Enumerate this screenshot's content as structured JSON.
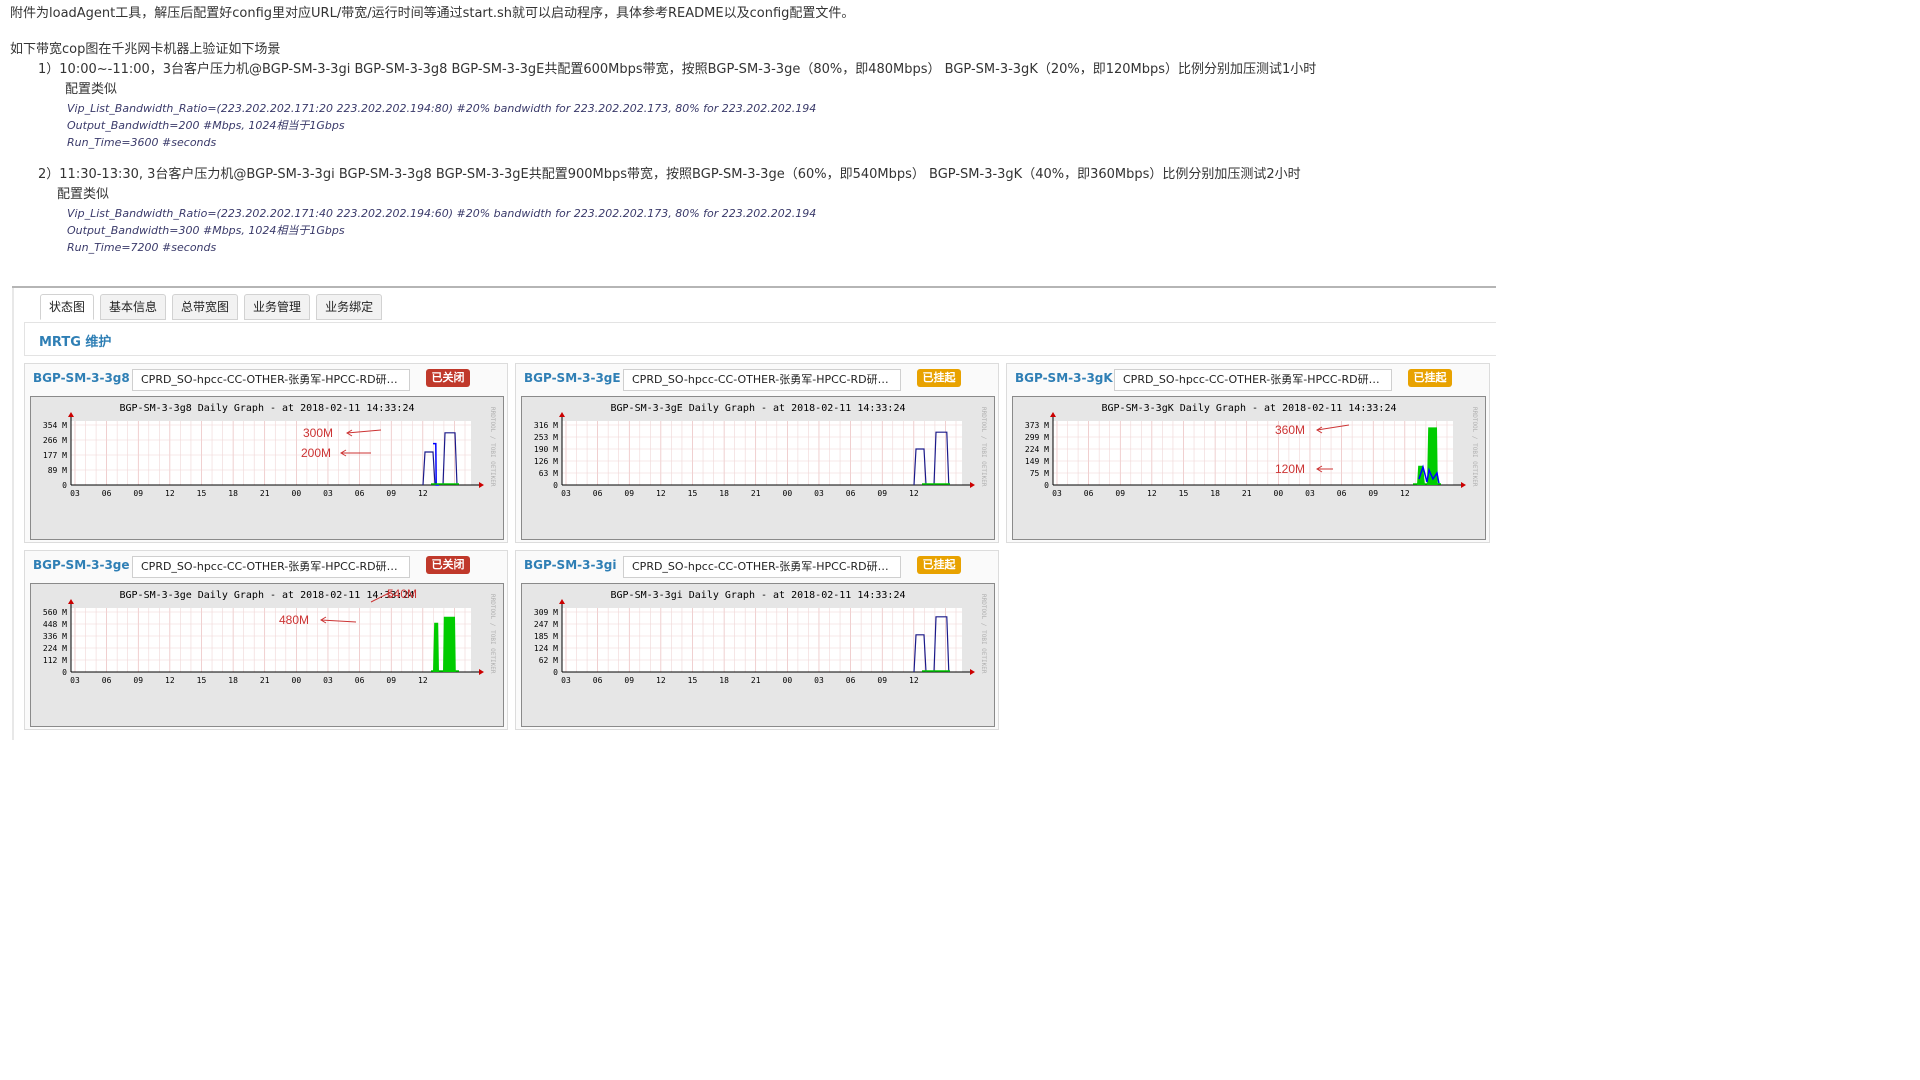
{
  "doc": {
    "line1": "附件为loadAgent工具，解压后配置好config里对应URL/带宽/运行时间等通过start.sh就可以启动程序，具体参考README以及config配置文件。",
    "line2": "如下带宽cop图在千兆网卡机器上验证如下场景",
    "s1_line": "1）10:00~-11:00，3台客户压力机@BGP-SM-3-3gi  BGP-SM-3-3g8  BGP-SM-3-3gE共配置600Mbps带宽，按照BGP-SM-3-3ge（80%，即480Mbps） BGP-SM-3-3gK（20%，即120Mbps）比例分别加压测试1小时",
    "s1_cfg_label": "配置类似",
    "s1_cfg1": "Vip_List_Bandwidth_Ratio=(223.202.202.171:20 223.202.202.194:80)  #20% bandwidth for 223.202.202.173, 80% for 223.202.202.194",
    "s1_cfg2": "Output_Bandwidth=200    #Mbps, 1024相当于1Gbps",
    "s1_cfg3": "Run_Time=3600    #seconds",
    "s2_line": "2）11:30-13:30, 3台客户压力机@BGP-SM-3-3gi  BGP-SM-3-3g8  BGP-SM-3-3gE共配置900Mbps带宽，按照BGP-SM-3-3ge（60%，即540Mbps） BGP-SM-3-3gK（40%，即360Mbps）比例分别加压测试2小时",
    "s2_cfg_label": "配置类似",
    "s2_cfg1": "Vip_List_Bandwidth_Ratio=(223.202.202.171:40 223.202.202.194:60)  #20% bandwidth for 223.202.202.173, 80% for 223.202.202.194",
    "s2_cfg2": "Output_Bandwidth=300    #Mbps, 1024相当于1Gbps",
    "s2_cfg3": "Run_Time=7200    #seconds"
  },
  "tabs": [
    {
      "label": "状态图",
      "active": true
    },
    {
      "label": "基本信息",
      "active": false
    },
    {
      "label": "总带宽图",
      "active": false
    },
    {
      "label": "业务管理",
      "active": false
    },
    {
      "label": "业务绑定",
      "active": false
    }
  ],
  "section_title": "MRTG 维护",
  "cards": [
    {
      "name": "BGP-SM-3-3g8",
      "desc": "CPRD_SO-hpcc-CC-OTHER-张勇军-HPCC-RD研…",
      "badge": "已关闭",
      "badge_kind": "closed",
      "graph_title": "BGP-SM-3-3g8 Daily Graph - at 2018-02-11 14:33:24",
      "y_ticks": [
        "354 M",
        "266 M",
        "177 M",
        "89 M",
        "0"
      ],
      "annotations": [
        {
          "text": "300M"
        },
        {
          "text": "200M"
        }
      ]
    },
    {
      "name": "BGP-SM-3-3gE",
      "desc": "CPRD_SO-hpcc-CC-OTHER-张勇军-HPCC-RD研…",
      "badge": "已挂起",
      "badge_kind": "hung",
      "graph_title": "BGP-SM-3-3gE Daily Graph - at 2018-02-11 14:33:24",
      "y_ticks": [
        "316 M",
        "253 M",
        "190 M",
        "126 M",
        "63 M",
        "0"
      ],
      "annotations": []
    },
    {
      "name": "BGP-SM-3-3gK",
      "desc": "CPRD_SO-hpcc-CC-OTHER-张勇军-HPCC-RD研…",
      "badge": "已挂起",
      "badge_kind": "hung",
      "graph_title": "BGP-SM-3-3gK Daily Graph - at 2018-02-11 14:33:24",
      "y_ticks": [
        "373 M",
        "299 M",
        "224 M",
        "149 M",
        "75 M",
        "0"
      ],
      "annotations": [
        {
          "text": "360M"
        },
        {
          "text": "120M"
        }
      ]
    },
    {
      "name": "BGP-SM-3-3ge",
      "desc": "CPRD_SO-hpcc-CC-OTHER-张勇军-HPCC-RD研…",
      "badge": "已关闭",
      "badge_kind": "closed",
      "graph_title": "BGP-SM-3-3ge Daily Graph - at 2018-02-11 14:33:24",
      "y_ticks": [
        "560 M",
        "448 M",
        "336 M",
        "224 M",
        "112 M",
        "0"
      ],
      "annotations": [
        {
          "text": "540M"
        },
        {
          "text": "480M"
        }
      ]
    },
    {
      "name": "BGP-SM-3-3gi",
      "desc": "CPRD_SO-hpcc-CC-OTHER-张勇军-HPCC-RD研…",
      "badge": "已挂起",
      "badge_kind": "hung",
      "graph_title": "BGP-SM-3-3gi Daily Graph - at 2018-02-11 14:33:24",
      "y_ticks": [
        "309 M",
        "247 M",
        "185 M",
        "124 M",
        "62 M",
        "0"
      ],
      "annotations": []
    }
  ],
  "x_ticks": [
    "03",
    "06",
    "09",
    "12",
    "15",
    "18",
    "21",
    "00",
    "03",
    "06",
    "09",
    "12"
  ],
  "side_label": "RRDTOOL / TOBI OETIKER",
  "colors": {
    "in_traffic": "#00cc00",
    "out_traffic": "#0000ff",
    "annotation": "#cc3333",
    "badge_closed": "#c0392b",
    "badge_hung": "#e8a200",
    "link": "#2f7fb5"
  }
}
